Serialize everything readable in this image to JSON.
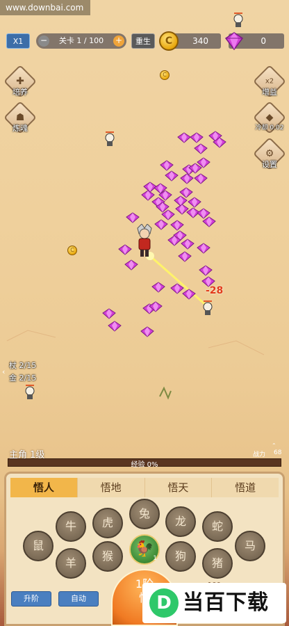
{
  "watermark": "www.downbai.com",
  "top_bar": {
    "speed": "X1",
    "level_text": "关卡 1 / 100",
    "minus": "−",
    "plus": "+",
    "rebirth": "重生",
    "coins": "340",
    "gems": "0"
  },
  "left_buttons": {
    "cultivate": "培养",
    "refine": "炼魂"
  },
  "right_buttons": {
    "boost": "增益",
    "boost_badge": "x2",
    "cooldown": "冷却 0.02",
    "settings": "设置"
  },
  "damage_number": "-28",
  "left_stats": {
    "staff_label": "杖",
    "staff_value": "2/15",
    "gold_label": "金",
    "gold_value": "2/15"
  },
  "hero": {
    "label": "主角 1级",
    "power_label": "战力",
    "power_value": "68"
  },
  "experience": {
    "text": "经验 0%",
    "fill": 0
  },
  "tabs": [
    "悟人",
    "悟地",
    "悟天",
    "悟道"
  ],
  "zodiac": [
    "鼠",
    "牛",
    "羊",
    "虎",
    "猴",
    "兔",
    "龙",
    "狗",
    "蛇",
    "猪",
    "马"
  ],
  "rooster_count": "1",
  "buttons": {
    "upgrade": "升阶",
    "auto": "自动"
  },
  "big_button": {
    "line1": "1阶",
    "line2": "悟"
  },
  "cost": "x100",
  "logo": {
    "mark": "D",
    "text": "当百下载"
  },
  "colors": {
    "gem": "#d23fd6",
    "accent": "#f2b64a",
    "blue_button": "#4a7fc0"
  }
}
